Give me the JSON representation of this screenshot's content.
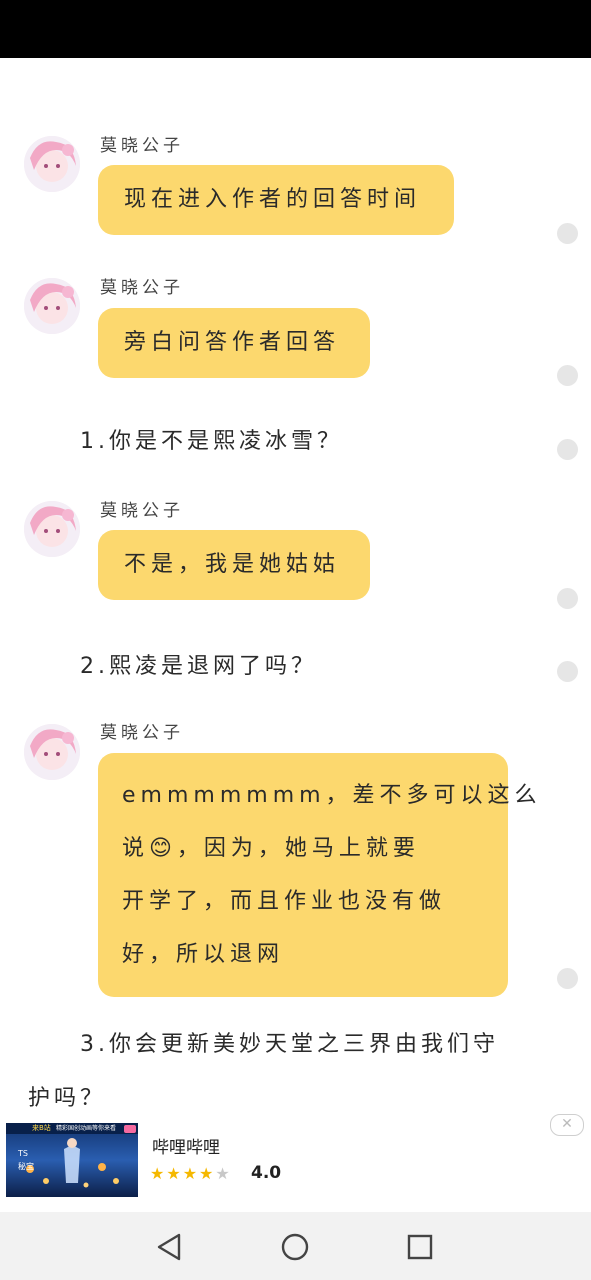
{
  "chat": {
    "messages": [
      {
        "sender": "莫晓公子",
        "text": "现在进入作者的回答时间"
      },
      {
        "sender": "莫晓公子",
        "text": "旁白问答作者回答"
      },
      {
        "sender": "莫晓公子",
        "text": "不是，我是她姑姑"
      },
      {
        "sender": "莫晓公子",
        "lines": [
          "emmmmmmm，差不多可以这么",
          "说😊，因为，她马上就要",
          "开学了，而且作业也没有做",
          "好，所以退网"
        ]
      }
    ],
    "questions": [
      {
        "text": "1.你是不是熙凌冰雪？"
      },
      {
        "text": "2.熙凌是退网了吗？"
      },
      {
        "lines": [
          "3.你会更新美妙天堂之三界由我们守",
          "护吗？"
        ]
      }
    ]
  },
  "ad": {
    "title": "哔哩哔哩",
    "rating": "4.0",
    "stars": 4,
    "close_icon": "close-icon",
    "image_text": [
      "来B站",
      "精彩国创动画等你来看",
      "TS",
      "秘宝"
    ]
  },
  "nav": {
    "back_icon": "back-triangle-icon",
    "home_icon": "home-circle-icon",
    "recents_icon": "recents-square-icon"
  },
  "colors": {
    "bubble": "#fcd86e",
    "status_bar": "#000000",
    "nav_bar": "#f2f2f2",
    "star_on": "#f5b800"
  }
}
